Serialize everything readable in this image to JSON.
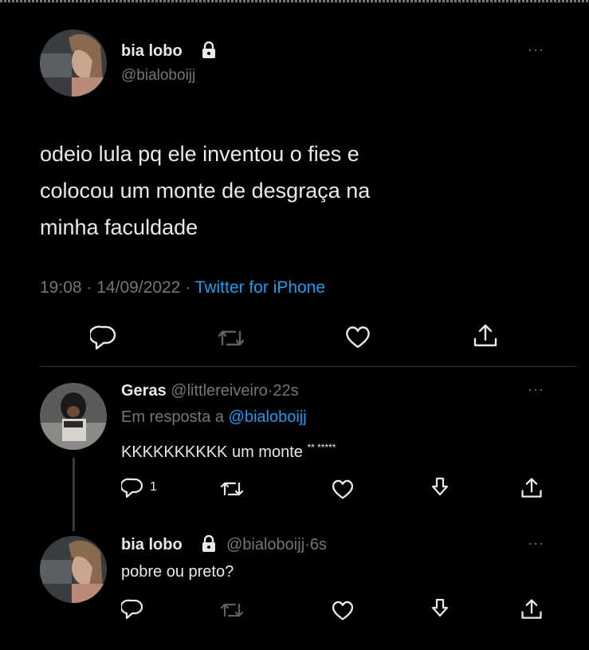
{
  "main_tweet": {
    "display_name": "bia lobo",
    "handle": "@bialoboijj",
    "text_lines": [
      "odeio lula pq ele inventou o fies e",
      "colocou um monte de desgraça na",
      "minha faculdade"
    ],
    "time": "19:08",
    "date": "14/09/2022",
    "separator": "·",
    "source": "Twitter for iPhone"
  },
  "reply1": {
    "display_name": "Geras",
    "handle": "@littlereiveiro",
    "sep": "·",
    "age": "22s",
    "reply_to_label": "Em resposta a",
    "reply_to_handle": "@bialoboijj",
    "text": "KKKKKKKKKK um monte",
    "text_suffix": "** *****",
    "reply_count": "1"
  },
  "reply2": {
    "display_name": "bia lobo",
    "handle": "@bialoboijj",
    "sep": "·",
    "age": "6s",
    "text": "pobre ou preto?"
  },
  "icons": [
    "lock-icon",
    "more-icon",
    "reply-icon",
    "retweet-icon",
    "like-icon",
    "share-icon",
    "download-icon"
  ],
  "colors": {
    "background": "#000000",
    "text": "#e7e9ea",
    "muted": "#71767b",
    "link": "#1d9bf0"
  }
}
